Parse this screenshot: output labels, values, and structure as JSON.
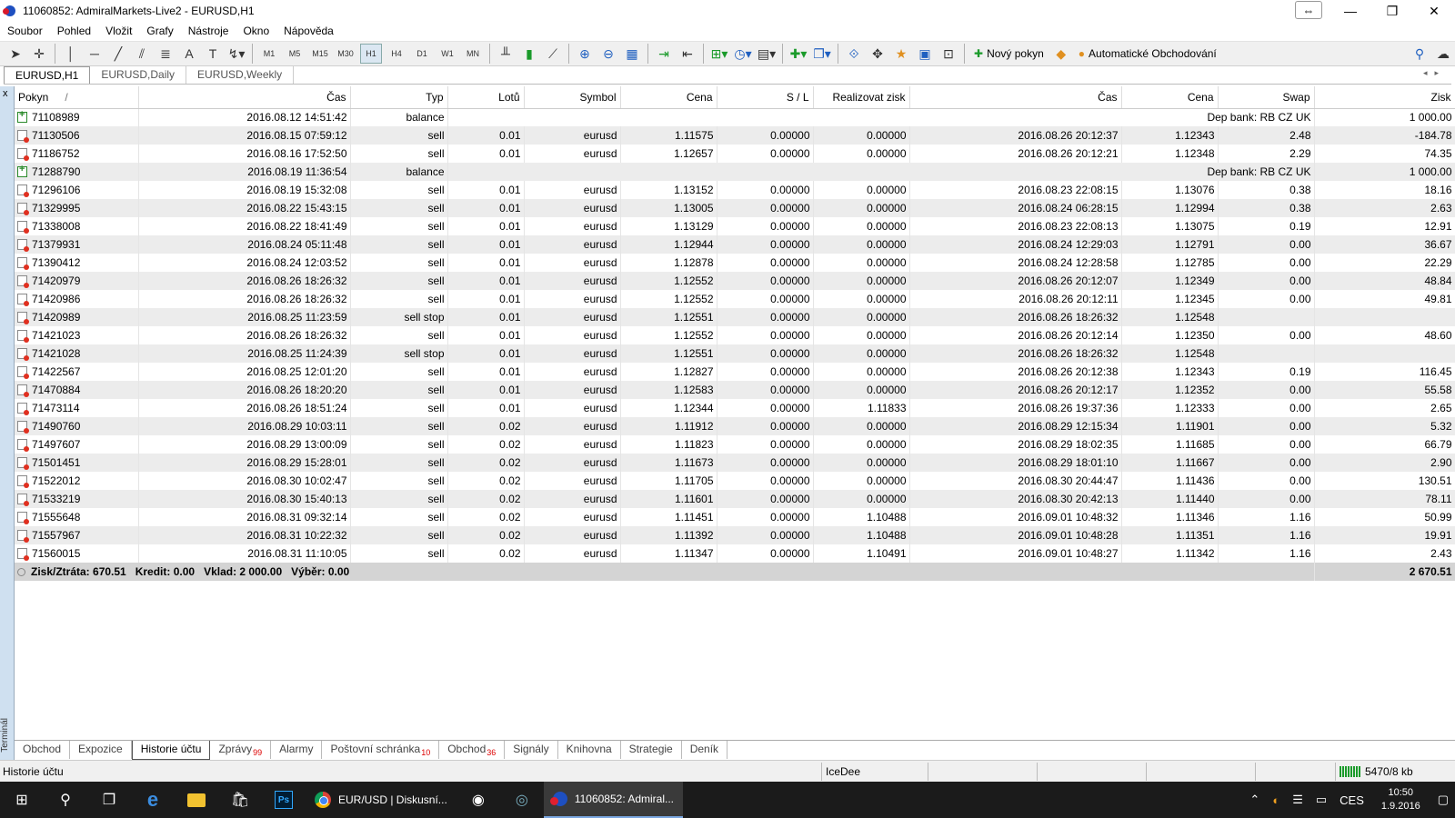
{
  "window": {
    "title": "11060852: AdmiralMarkets-Live2 - EURUSD,H1",
    "resize_icon": "⇔",
    "minimize_icon": "—",
    "restore_icon": "❐",
    "close_icon": "✕"
  },
  "menu": [
    "Soubor",
    "Pohled",
    "Vložit",
    "Grafy",
    "Nástroje",
    "Okno",
    "Nápověda"
  ],
  "toolbar": {
    "timeframes": [
      "M1",
      "M5",
      "M15",
      "M30",
      "H1",
      "H4",
      "D1",
      "W1",
      "MN"
    ],
    "active_timeframe": "H1",
    "new_order": "Nový pokyn",
    "auto_trading": "Automatické Obchodování"
  },
  "chart_tabs": [
    "EURUSD,H1",
    "EURUSD,Daily",
    "EURUSD,Weekly"
  ],
  "table": {
    "headers": [
      "Pokyn",
      "/",
      "Čas",
      "Typ",
      "Lotů",
      "Symbol",
      "Cena",
      "S / L",
      "Realizovat zisk",
      "Čas",
      "Cena",
      "Swap",
      "Zisk"
    ],
    "rows": [
      {
        "kind": "balance",
        "order": "71108989",
        "time": "2016.08.12 14:51:42",
        "type": "balance",
        "comment": "Dep bank: RB CZ UK",
        "profit": "1 000.00"
      },
      {
        "kind": "sell",
        "order": "71130506",
        "time": "2016.08.15 07:59:12",
        "type": "sell",
        "lots": "0.01",
        "symbol": "eurusd",
        "price": "1.11575",
        "sl": "0.00000",
        "tp": "0.00000",
        "ctime": "2016.08.26 20:12:37",
        "cprice": "1.12343",
        "swap": "2.48",
        "profit": "-184.78"
      },
      {
        "kind": "sell",
        "order": "71186752",
        "time": "2016.08.16 17:52:50",
        "type": "sell",
        "lots": "0.01",
        "symbol": "eurusd",
        "price": "1.12657",
        "sl": "0.00000",
        "tp": "0.00000",
        "ctime": "2016.08.26 20:12:21",
        "cprice": "1.12348",
        "swap": "2.29",
        "profit": "74.35"
      },
      {
        "kind": "balance",
        "order": "71288790",
        "time": "2016.08.19 11:36:54",
        "type": "balance",
        "comment": "Dep bank: RB CZ UK",
        "profit": "1 000.00"
      },
      {
        "kind": "sell",
        "order": "71296106",
        "time": "2016.08.19 15:32:08",
        "type": "sell",
        "lots": "0.01",
        "symbol": "eurusd",
        "price": "1.13152",
        "sl": "0.00000",
        "tp": "0.00000",
        "ctime": "2016.08.23 22:08:15",
        "cprice": "1.13076",
        "swap": "0.38",
        "profit": "18.16"
      },
      {
        "kind": "sell",
        "order": "71329995",
        "time": "2016.08.22 15:43:15",
        "type": "sell",
        "lots": "0.01",
        "symbol": "eurusd",
        "price": "1.13005",
        "sl": "0.00000",
        "tp": "0.00000",
        "ctime": "2016.08.24 06:28:15",
        "cprice": "1.12994",
        "swap": "0.38",
        "profit": "2.63"
      },
      {
        "kind": "sell",
        "order": "71338008",
        "time": "2016.08.22 18:41:49",
        "type": "sell",
        "lots": "0.01",
        "symbol": "eurusd",
        "price": "1.13129",
        "sl": "0.00000",
        "tp": "0.00000",
        "ctime": "2016.08.23 22:08:13",
        "cprice": "1.13075",
        "swap": "0.19",
        "profit": "12.91"
      },
      {
        "kind": "sell",
        "order": "71379931",
        "time": "2016.08.24 05:11:48",
        "type": "sell",
        "lots": "0.01",
        "symbol": "eurusd",
        "price": "1.12944",
        "sl": "0.00000",
        "tp": "0.00000",
        "ctime": "2016.08.24 12:29:03",
        "cprice": "1.12791",
        "swap": "0.00",
        "profit": "36.67"
      },
      {
        "kind": "sell",
        "order": "71390412",
        "time": "2016.08.24 12:03:52",
        "type": "sell",
        "lots": "0.01",
        "symbol": "eurusd",
        "price": "1.12878",
        "sl": "0.00000",
        "tp": "0.00000",
        "ctime": "2016.08.24 12:28:58",
        "cprice": "1.12785",
        "swap": "0.00",
        "profit": "22.29"
      },
      {
        "kind": "sell",
        "order": "71420979",
        "time": "2016.08.26 18:26:32",
        "type": "sell",
        "lots": "0.01",
        "symbol": "eurusd",
        "price": "1.12552",
        "sl": "0.00000",
        "tp": "0.00000",
        "ctime": "2016.08.26 20:12:07",
        "cprice": "1.12349",
        "swap": "0.00",
        "profit": "48.84"
      },
      {
        "kind": "sell",
        "order": "71420986",
        "time": "2016.08.26 18:26:32",
        "type": "sell",
        "lots": "0.01",
        "symbol": "eurusd",
        "price": "1.12552",
        "sl": "0.00000",
        "tp": "0.00000",
        "ctime": "2016.08.26 20:12:11",
        "cprice": "1.12345",
        "swap": "0.00",
        "profit": "49.81"
      },
      {
        "kind": "sell",
        "order": "71420989",
        "time": "2016.08.25 11:23:59",
        "type": "sell stop",
        "lots": "0.01",
        "symbol": "eurusd",
        "price": "1.12551",
        "sl": "0.00000",
        "tp": "0.00000",
        "ctime": "2016.08.26 18:26:32",
        "cprice": "1.12548",
        "swap": "",
        "profit": ""
      },
      {
        "kind": "sell",
        "order": "71421023",
        "time": "2016.08.26 18:26:32",
        "type": "sell",
        "lots": "0.01",
        "symbol": "eurusd",
        "price": "1.12552",
        "sl": "0.00000",
        "tp": "0.00000",
        "ctime": "2016.08.26 20:12:14",
        "cprice": "1.12350",
        "swap": "0.00",
        "profit": "48.60"
      },
      {
        "kind": "sell",
        "order": "71421028",
        "time": "2016.08.25 11:24:39",
        "type": "sell stop",
        "lots": "0.01",
        "symbol": "eurusd",
        "price": "1.12551",
        "sl": "0.00000",
        "tp": "0.00000",
        "ctime": "2016.08.26 18:26:32",
        "cprice": "1.12548",
        "swap": "",
        "profit": ""
      },
      {
        "kind": "sell",
        "order": "71422567",
        "time": "2016.08.25 12:01:20",
        "type": "sell",
        "lots": "0.01",
        "symbol": "eurusd",
        "price": "1.12827",
        "sl": "0.00000",
        "tp": "0.00000",
        "ctime": "2016.08.26 20:12:38",
        "cprice": "1.12343",
        "swap": "0.19",
        "profit": "116.45"
      },
      {
        "kind": "sell",
        "order": "71470884",
        "time": "2016.08.26 18:20:20",
        "type": "sell",
        "lots": "0.01",
        "symbol": "eurusd",
        "price": "1.12583",
        "sl": "0.00000",
        "tp": "0.00000",
        "ctime": "2016.08.26 20:12:17",
        "cprice": "1.12352",
        "swap": "0.00",
        "profit": "55.58"
      },
      {
        "kind": "sell",
        "order": "71473114",
        "time": "2016.08.26 18:51:24",
        "type": "sell",
        "lots": "0.01",
        "symbol": "eurusd",
        "price": "1.12344",
        "sl": "0.00000",
        "tp": "1.11833",
        "ctime": "2016.08.26 19:37:36",
        "cprice": "1.12333",
        "swap": "0.00",
        "profit": "2.65"
      },
      {
        "kind": "sell",
        "order": "71490760",
        "time": "2016.08.29 10:03:11",
        "type": "sell",
        "lots": "0.02",
        "symbol": "eurusd",
        "price": "1.11912",
        "sl": "0.00000",
        "tp": "0.00000",
        "ctime": "2016.08.29 12:15:34",
        "cprice": "1.11901",
        "swap": "0.00",
        "profit": "5.32"
      },
      {
        "kind": "sell",
        "order": "71497607",
        "time": "2016.08.29 13:00:09",
        "type": "sell",
        "lots": "0.02",
        "symbol": "eurusd",
        "price": "1.11823",
        "sl": "0.00000",
        "tp": "0.00000",
        "ctime": "2016.08.29 18:02:35",
        "cprice": "1.11685",
        "swap": "0.00",
        "profit": "66.79"
      },
      {
        "kind": "sell",
        "order": "71501451",
        "time": "2016.08.29 15:28:01",
        "type": "sell",
        "lots": "0.02",
        "symbol": "eurusd",
        "price": "1.11673",
        "sl": "0.00000",
        "tp": "0.00000",
        "ctime": "2016.08.29 18:01:10",
        "cprice": "1.11667",
        "swap": "0.00",
        "profit": "2.90"
      },
      {
        "kind": "sell",
        "order": "71522012",
        "time": "2016.08.30 10:02:47",
        "type": "sell",
        "lots": "0.02",
        "symbol": "eurusd",
        "price": "1.11705",
        "sl": "0.00000",
        "tp": "0.00000",
        "ctime": "2016.08.30 20:44:47",
        "cprice": "1.11436",
        "swap": "0.00",
        "profit": "130.51"
      },
      {
        "kind": "sell",
        "order": "71533219",
        "time": "2016.08.30 15:40:13",
        "type": "sell",
        "lots": "0.02",
        "symbol": "eurusd",
        "price": "1.11601",
        "sl": "0.00000",
        "tp": "0.00000",
        "ctime": "2016.08.30 20:42:13",
        "cprice": "1.11440",
        "swap": "0.00",
        "profit": "78.11"
      },
      {
        "kind": "sell",
        "order": "71555648",
        "time": "2016.08.31 09:32:14",
        "type": "sell",
        "lots": "0.02",
        "symbol": "eurusd",
        "price": "1.11451",
        "sl": "0.00000",
        "tp": "1.10488",
        "ctime": "2016.09.01 10:48:32",
        "cprice": "1.11346",
        "swap": "1.16",
        "profit": "50.99"
      },
      {
        "kind": "sell",
        "order": "71557967",
        "time": "2016.08.31 10:22:32",
        "type": "sell",
        "lots": "0.02",
        "symbol": "eurusd",
        "price": "1.11392",
        "sl": "0.00000",
        "tp": "1.10488",
        "ctime": "2016.09.01 10:48:28",
        "cprice": "1.11351",
        "swap": "1.16",
        "profit": "19.91"
      },
      {
        "kind": "sell",
        "order": "71560015",
        "time": "2016.08.31 11:10:05",
        "type": "sell",
        "lots": "0.02",
        "symbol": "eurusd",
        "price": "1.11347",
        "sl": "0.00000",
        "tp": "1.10491",
        "ctime": "2016.09.01 10:48:27",
        "cprice": "1.11342",
        "swap": "1.16",
        "profit": "2.43"
      }
    ],
    "summary": "Zisk/Ztráta: 670.51   Kredit: 0.00   Vklad: 2 000.00   Výběr: 0.00",
    "summary_total": "2 670.51"
  },
  "terminal_label": "Terminál",
  "terminal_close": "x",
  "bottom_tabs": [
    {
      "label": "Obchod",
      "badge": ""
    },
    {
      "label": "Expozice",
      "badge": ""
    },
    {
      "label": "Historie účtu",
      "badge": ""
    },
    {
      "label": "Zprávy",
      "badge": "99"
    },
    {
      "label": "Alarmy",
      "badge": ""
    },
    {
      "label": "Poštovní schránka",
      "badge": "10"
    },
    {
      "label": "Obchod",
      "badge": "36"
    },
    {
      "label": "Signály",
      "badge": ""
    },
    {
      "label": "Knihovna",
      "badge": ""
    },
    {
      "label": "Strategie",
      "badge": ""
    },
    {
      "label": "Deník",
      "badge": ""
    }
  ],
  "active_bottom_tab": 2,
  "status": {
    "left": "Historie účtu",
    "user": "IceDee",
    "net": "5470/8 kb"
  },
  "taskbar": {
    "chrome_title": "EUR/USD | Diskusní...",
    "mt4_title": "11060852: Admiral...",
    "lang": "CES",
    "time": "10:50",
    "date": "1.9.2016"
  }
}
